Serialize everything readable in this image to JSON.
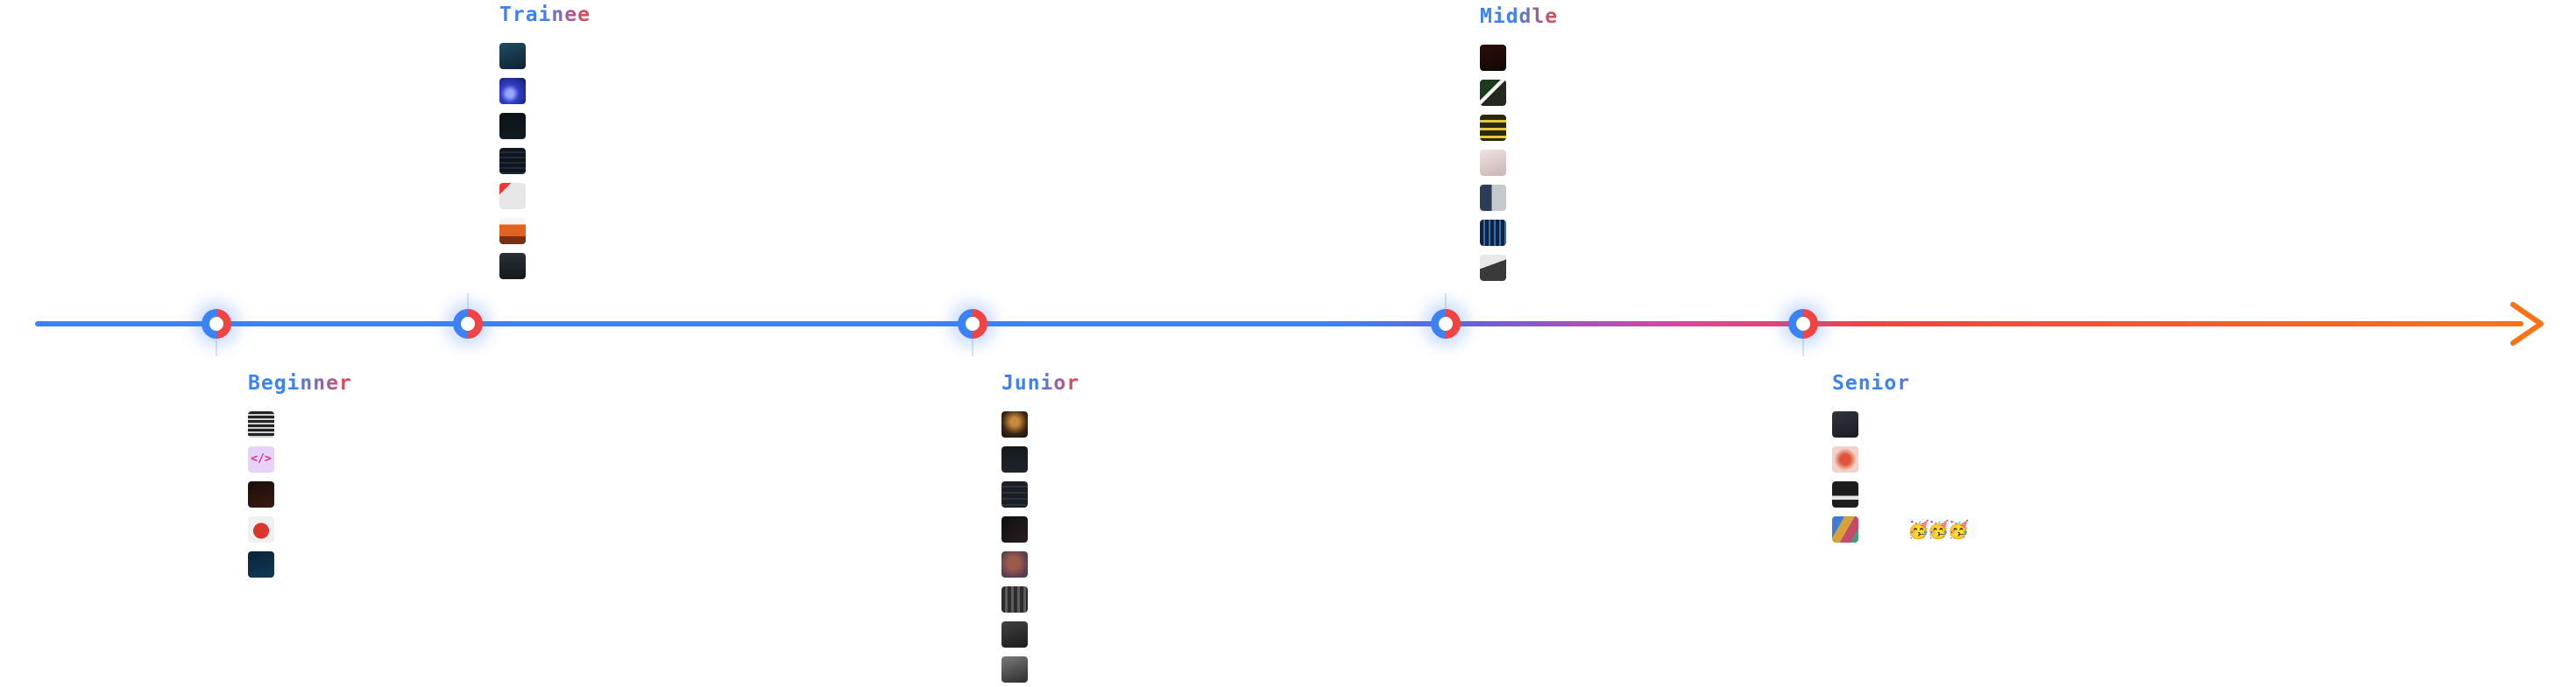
{
  "arrow": {
    "colors": {
      "start": "#3b82f6",
      "mid": "#d946a0",
      "end": "#f97316"
    }
  },
  "stages": {
    "trainee": {
      "title": "Trainee",
      "items": [
        {
          "icon": "circuit-board-image-icon"
        },
        {
          "icon": "blue-light-image-icon"
        },
        {
          "icon": "dark-screen-image-icon"
        },
        {
          "icon": "code-screen-image-icon"
        },
        {
          "icon": "red-logo-image-icon"
        },
        {
          "icon": "laptop-orange-image-icon"
        },
        {
          "icon": "dark-desk-image-icon"
        }
      ]
    },
    "beginner": {
      "title": "Beginner",
      "items": [
        {
          "icon": "server-rack-image-icon"
        },
        {
          "icon": "html-tag-icon",
          "glyph": "</>"
        },
        {
          "icon": "dark-code-image-icon"
        },
        {
          "icon": "ruby-gem-image-icon"
        },
        {
          "icon": "blue-terminal-image-icon"
        }
      ]
    },
    "junior": {
      "title": "Junior",
      "items": [
        {
          "icon": "lamp-image-icon"
        },
        {
          "icon": "dark-screen-image-icon"
        },
        {
          "icon": "code-lines-image-icon"
        },
        {
          "icon": "terminal-image-icon"
        },
        {
          "icon": "colorful-pattern-image-icon"
        },
        {
          "icon": "server-image-icon"
        },
        {
          "icon": "gray-machine-image-icon"
        },
        {
          "icon": "gray-hand-image-icon"
        }
      ]
    },
    "middle": {
      "title": "Middle",
      "items": [
        {
          "icon": "dark-red-image-icon"
        },
        {
          "icon": "green-board-image-icon"
        },
        {
          "icon": "yellow-stripes-image-icon"
        },
        {
          "icon": "pink-abstract-image-icon"
        },
        {
          "icon": "blue-panel-image-icon"
        },
        {
          "icon": "blue-data-image-icon"
        },
        {
          "icon": "white-object-image-icon"
        }
      ]
    },
    "senior": {
      "title": "Senior",
      "items": [
        {
          "icon": "dark-laptop-image-icon"
        },
        {
          "icon": "red-pattern-image-icon"
        },
        {
          "icon": "white-logo-image-icon"
        },
        {
          "icon": "colorful-art-image-icon",
          "note": "🥳🥳🥳"
        }
      ]
    }
  }
}
